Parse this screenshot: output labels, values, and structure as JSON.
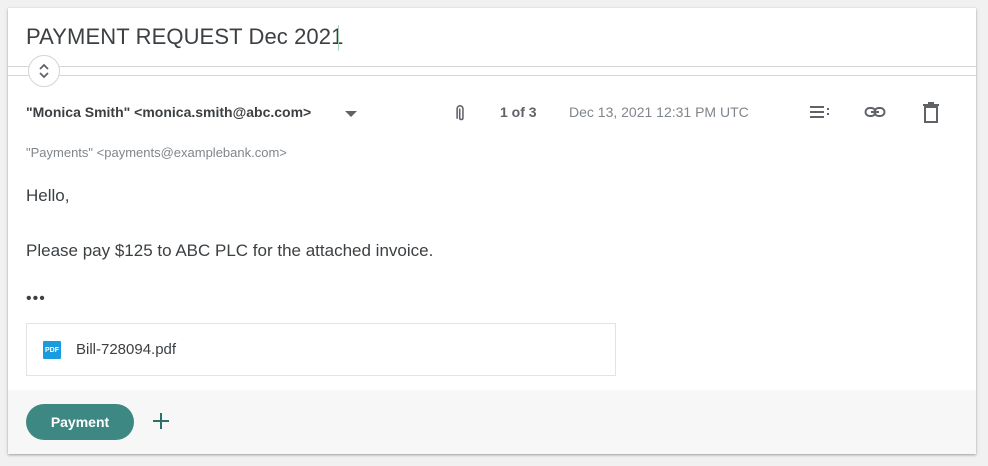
{
  "email": {
    "subject": "PAYMENT REQUEST Dec 2021",
    "from": "\"Monica Smith\" <monica.smith@abc.com>",
    "to": "\"Payments\" <payments@examplebank.com>",
    "count": "1 of 3",
    "date": "Dec 13, 2021 12:31 PM UTC",
    "body": {
      "greeting": "Hello,",
      "line1": "Please pay $125 to ABC PLC for the attached invoice.",
      "ellipsis": "•••"
    },
    "attachment": {
      "type_label": "PDF",
      "name": "Bill-728094.pdf"
    }
  },
  "actions": {
    "payment_label": "Payment"
  },
  "icons": {
    "expand": "unfold-more-icon",
    "dropdown": "caret-down-icon",
    "attachment": "paperclip-icon",
    "options": "menu-lines-icon",
    "link": "link-icon",
    "delete": "trash-icon",
    "add": "plus-icon",
    "file": "pdf-icon"
  },
  "colors": {
    "accent": "#3d8882",
    "pdf": "#1a9be0"
  }
}
